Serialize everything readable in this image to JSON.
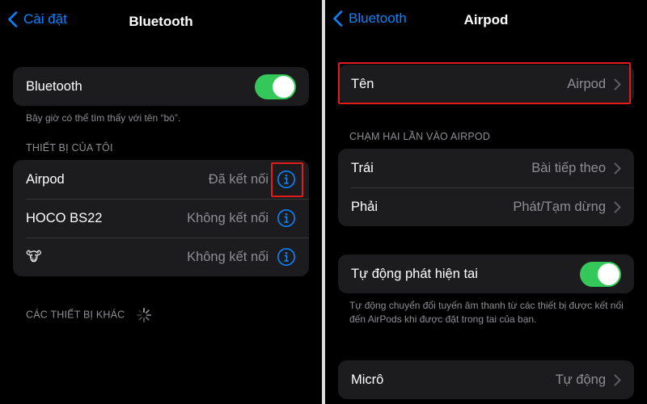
{
  "left": {
    "back_label": "Cài đặt",
    "title": "Bluetooth",
    "bluetooth_toggle": {
      "label": "Bluetooth",
      "on": true
    },
    "discoverable_text": "Bây giờ có thể tìm thấy với tên “bò”.",
    "my_devices_header": "THIẾT BỊ CỦA TÔI",
    "devices": [
      {
        "name": "Airpod",
        "status": "Đã kết nối"
      },
      {
        "name": "HOCO BS22",
        "status": "Không kết nối"
      },
      {
        "name": "🐮",
        "status": "Không kết nối"
      }
    ],
    "other_devices_header": "CÁC THIẾT BỊ KHÁC"
  },
  "right": {
    "back_label": "Bluetooth",
    "title": "Airpod",
    "name_row": {
      "label": "Tên",
      "value": "Airpod"
    },
    "double_tap_header": "CHẠM HAI LẦN VÀO AIRPOD",
    "double_tap": [
      {
        "label": "Trái",
        "value": "Bài tiếp theo"
      },
      {
        "label": "Phải",
        "value": "Phát/Tạm dừng"
      }
    ],
    "auto_ear": {
      "label": "Tự động phát hiện tai",
      "on": true
    },
    "auto_ear_footer": "Tự động chuyển đổi tuyến âm thanh từ các thiết bị được kết nối đến AirPods khi được đặt trong tai của bạn.",
    "mic_row": {
      "label": "Micrô",
      "value": "Tự động"
    }
  },
  "colors": {
    "accent": "#0a84ff",
    "switch_on": "#34c759",
    "highlight": "#e21b1b",
    "cell_bg": "#1c1c1e",
    "background": "#000000"
  }
}
